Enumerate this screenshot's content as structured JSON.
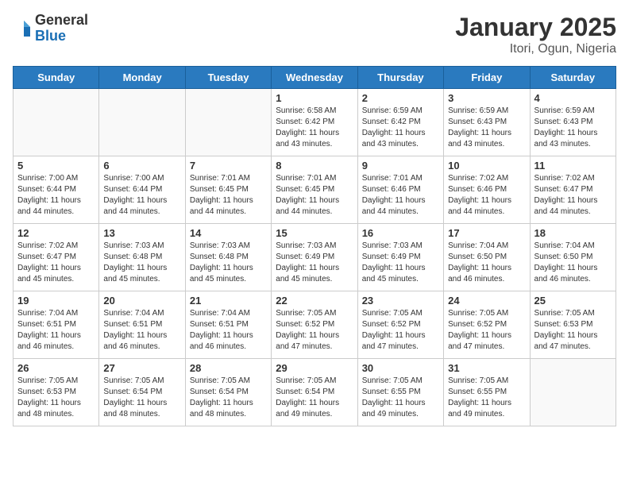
{
  "header": {
    "logo_line1": "General",
    "logo_line2": "Blue",
    "title": "January 2025",
    "subtitle": "Itori, Ogun, Nigeria"
  },
  "weekdays": [
    "Sunday",
    "Monday",
    "Tuesday",
    "Wednesday",
    "Thursday",
    "Friday",
    "Saturday"
  ],
  "weeks": [
    [
      {
        "day": "",
        "info": ""
      },
      {
        "day": "",
        "info": ""
      },
      {
        "day": "",
        "info": ""
      },
      {
        "day": "1",
        "info": "Sunrise: 6:58 AM\nSunset: 6:42 PM\nDaylight: 11 hours\nand 43 minutes."
      },
      {
        "day": "2",
        "info": "Sunrise: 6:59 AM\nSunset: 6:42 PM\nDaylight: 11 hours\nand 43 minutes."
      },
      {
        "day": "3",
        "info": "Sunrise: 6:59 AM\nSunset: 6:43 PM\nDaylight: 11 hours\nand 43 minutes."
      },
      {
        "day": "4",
        "info": "Sunrise: 6:59 AM\nSunset: 6:43 PM\nDaylight: 11 hours\nand 43 minutes."
      }
    ],
    [
      {
        "day": "5",
        "info": "Sunrise: 7:00 AM\nSunset: 6:44 PM\nDaylight: 11 hours\nand 44 minutes."
      },
      {
        "day": "6",
        "info": "Sunrise: 7:00 AM\nSunset: 6:44 PM\nDaylight: 11 hours\nand 44 minutes."
      },
      {
        "day": "7",
        "info": "Sunrise: 7:01 AM\nSunset: 6:45 PM\nDaylight: 11 hours\nand 44 minutes."
      },
      {
        "day": "8",
        "info": "Sunrise: 7:01 AM\nSunset: 6:45 PM\nDaylight: 11 hours\nand 44 minutes."
      },
      {
        "day": "9",
        "info": "Sunrise: 7:01 AM\nSunset: 6:46 PM\nDaylight: 11 hours\nand 44 minutes."
      },
      {
        "day": "10",
        "info": "Sunrise: 7:02 AM\nSunset: 6:46 PM\nDaylight: 11 hours\nand 44 minutes."
      },
      {
        "day": "11",
        "info": "Sunrise: 7:02 AM\nSunset: 6:47 PM\nDaylight: 11 hours\nand 44 minutes."
      }
    ],
    [
      {
        "day": "12",
        "info": "Sunrise: 7:02 AM\nSunset: 6:47 PM\nDaylight: 11 hours\nand 45 minutes."
      },
      {
        "day": "13",
        "info": "Sunrise: 7:03 AM\nSunset: 6:48 PM\nDaylight: 11 hours\nand 45 minutes."
      },
      {
        "day": "14",
        "info": "Sunrise: 7:03 AM\nSunset: 6:48 PM\nDaylight: 11 hours\nand 45 minutes."
      },
      {
        "day": "15",
        "info": "Sunrise: 7:03 AM\nSunset: 6:49 PM\nDaylight: 11 hours\nand 45 minutes."
      },
      {
        "day": "16",
        "info": "Sunrise: 7:03 AM\nSunset: 6:49 PM\nDaylight: 11 hours\nand 45 minutes."
      },
      {
        "day": "17",
        "info": "Sunrise: 7:04 AM\nSunset: 6:50 PM\nDaylight: 11 hours\nand 46 minutes."
      },
      {
        "day": "18",
        "info": "Sunrise: 7:04 AM\nSunset: 6:50 PM\nDaylight: 11 hours\nand 46 minutes."
      }
    ],
    [
      {
        "day": "19",
        "info": "Sunrise: 7:04 AM\nSunset: 6:51 PM\nDaylight: 11 hours\nand 46 minutes."
      },
      {
        "day": "20",
        "info": "Sunrise: 7:04 AM\nSunset: 6:51 PM\nDaylight: 11 hours\nand 46 minutes."
      },
      {
        "day": "21",
        "info": "Sunrise: 7:04 AM\nSunset: 6:51 PM\nDaylight: 11 hours\nand 46 minutes."
      },
      {
        "day": "22",
        "info": "Sunrise: 7:05 AM\nSunset: 6:52 PM\nDaylight: 11 hours\nand 47 minutes."
      },
      {
        "day": "23",
        "info": "Sunrise: 7:05 AM\nSunset: 6:52 PM\nDaylight: 11 hours\nand 47 minutes."
      },
      {
        "day": "24",
        "info": "Sunrise: 7:05 AM\nSunset: 6:52 PM\nDaylight: 11 hours\nand 47 minutes."
      },
      {
        "day": "25",
        "info": "Sunrise: 7:05 AM\nSunset: 6:53 PM\nDaylight: 11 hours\nand 47 minutes."
      }
    ],
    [
      {
        "day": "26",
        "info": "Sunrise: 7:05 AM\nSunset: 6:53 PM\nDaylight: 11 hours\nand 48 minutes."
      },
      {
        "day": "27",
        "info": "Sunrise: 7:05 AM\nSunset: 6:54 PM\nDaylight: 11 hours\nand 48 minutes."
      },
      {
        "day": "28",
        "info": "Sunrise: 7:05 AM\nSunset: 6:54 PM\nDaylight: 11 hours\nand 48 minutes."
      },
      {
        "day": "29",
        "info": "Sunrise: 7:05 AM\nSunset: 6:54 PM\nDaylight: 11 hours\nand 49 minutes."
      },
      {
        "day": "30",
        "info": "Sunrise: 7:05 AM\nSunset: 6:55 PM\nDaylight: 11 hours\nand 49 minutes."
      },
      {
        "day": "31",
        "info": "Sunrise: 7:05 AM\nSunset: 6:55 PM\nDaylight: 11 hours\nand 49 minutes."
      },
      {
        "day": "",
        "info": ""
      }
    ]
  ]
}
